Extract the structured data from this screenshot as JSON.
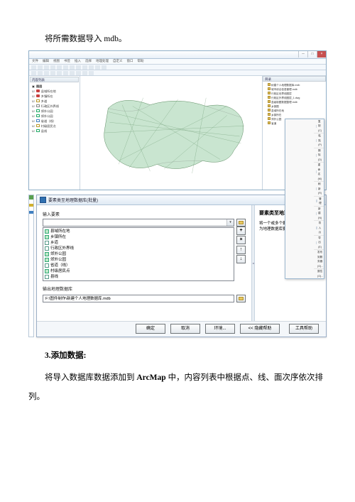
{
  "doc": {
    "p1": "将所需数据导入 mdb。",
    "heading": "3.添加数据:",
    "p2_a": "将导入数据库数据添加到 ",
    "p2_b": "ArcMap",
    "p2_c": " 中，内容列表中根据点、线、面次序依次排列。"
  },
  "arcmap": {
    "menus": [
      "文件",
      "编辑",
      "视图",
      "书签",
      "插入",
      "选择",
      "地理处理",
      "自定义",
      "窗口",
      "帮助"
    ],
    "toc_title": "内容列表",
    "layers_title": "图层",
    "layers": [
      {
        "name": "县域所在地",
        "sym": "ls-red"
      },
      {
        "name": "乡镇所在",
        "sym": "ls-red"
      },
      {
        "name": "乡道",
        "sym": "ls-yel"
      },
      {
        "name": "行政区外界线",
        "sym": "ls-gry"
      },
      {
        "name": "郊外公园",
        "sym": "ls-grn"
      },
      {
        "name": "郊外公园",
        "sym": "ls-grn"
      },
      {
        "name": "省道（线）",
        "sym": "ls-blu"
      },
      {
        "name": "村级居民点",
        "sym": "ls-yel"
      },
      {
        "name": "县线",
        "sym": "ls-grn"
      }
    ],
    "catalog_title": "目录",
    "catalog_items": [
      "树建个人地理数据库.mdb",
      "城市综合信息管理.mdb",
      "行政区划界线图层",
      "行政区外界线图层_1.dwg",
      "县级制图数据整理.mdb",
      "乡镇图",
      "县域所在地",
      "乡镇所在",
      "郊外公园",
      "省道"
    ],
    "ctx_menu": [
      "复制(C)",
      "粘贴(P)",
      "删除(D)",
      "重命名(M)",
      "刷新(R)",
      "管理",
      "新建(N)",
      "导入(I)",
      "导出(E)",
      "发布到服务器(G)...",
      "属性(O)..."
    ]
  },
  "dialog": {
    "title": "要素类至地理数据库(批量)",
    "input_label": "输入要素",
    "features": [
      "县域所在地",
      "乡镇所在",
      "乡道",
      "行政区外界线",
      "郊外公园",
      "郊外公园",
      "省道（线）",
      "村级居民点",
      "县线"
    ],
    "side_glyphs": [
      "+",
      "×",
      "↑",
      "↓"
    ],
    "output_label": "输出地理数据库",
    "output_value": "F:\\图件制作\\新建个人地理数据库.mdb",
    "buttons": {
      "ok": "确定",
      "cancel": "取消",
      "env": "环境...",
      "help": "<< 隐藏帮助",
      "toolhelp": "工具帮助"
    },
    "help": {
      "title": "要素类至地理数据库(批量)",
      "body": "将一个或多个要素类/要素图层转换为地理数据库要素类。"
    }
  }
}
